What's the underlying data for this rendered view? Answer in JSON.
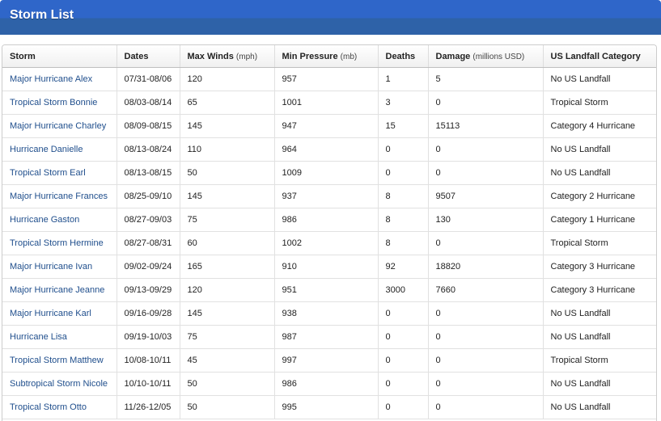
{
  "header": {
    "title": "Storm List"
  },
  "table": {
    "columns": [
      {
        "label": "Storm",
        "unit": ""
      },
      {
        "label": "Dates",
        "unit": ""
      },
      {
        "label": "Max Winds",
        "unit": "(mph)"
      },
      {
        "label": "Min Pressure",
        "unit": "(mb)"
      },
      {
        "label": "Deaths",
        "unit": ""
      },
      {
        "label": "Damage",
        "unit": "(millions USD)"
      },
      {
        "label": "US Landfall Category",
        "unit": ""
      }
    ],
    "rows": [
      [
        "Major Hurricane Alex",
        "07/31-08/06",
        "120",
        "957",
        "1",
        "5",
        "No US Landfall"
      ],
      [
        "Tropical Storm Bonnie",
        "08/03-08/14",
        "65",
        "1001",
        "3",
        "0",
        "Tropical Storm"
      ],
      [
        "Major Hurricane Charley",
        "08/09-08/15",
        "145",
        "947",
        "15",
        "15113",
        "Category 4 Hurricane"
      ],
      [
        "Hurricane Danielle",
        "08/13-08/24",
        "110",
        "964",
        "0",
        "0",
        "No US Landfall"
      ],
      [
        "Tropical Storm Earl",
        "08/13-08/15",
        "50",
        "1009",
        "0",
        "0",
        "No US Landfall"
      ],
      [
        "Major Hurricane Frances",
        "08/25-09/10",
        "145",
        "937",
        "8",
        "9507",
        "Category 2 Hurricane"
      ],
      [
        "Hurricane Gaston",
        "08/27-09/03",
        "75",
        "986",
        "8",
        "130",
        "Category 1 Hurricane"
      ],
      [
        "Tropical Storm Hermine",
        "08/27-08/31",
        "60",
        "1002",
        "8",
        "0",
        "Tropical Storm"
      ],
      [
        "Major Hurricane Ivan",
        "09/02-09/24",
        "165",
        "910",
        "92",
        "18820",
        "Category 3 Hurricane"
      ],
      [
        "Major Hurricane Jeanne",
        "09/13-09/29",
        "120",
        "951",
        "3000",
        "7660",
        "Category 3 Hurricane"
      ],
      [
        "Major Hurricane Karl",
        "09/16-09/28",
        "145",
        "938",
        "0",
        "0",
        "No US Landfall"
      ],
      [
        "Hurricane Lisa",
        "09/19-10/03",
        "75",
        "987",
        "0",
        "0",
        "No US Landfall"
      ],
      [
        "Tropical Storm Matthew",
        "10/08-10/11",
        "45",
        "997",
        "0",
        "0",
        "Tropical Storm"
      ],
      [
        "Subtropical Storm Nicole",
        "10/10-10/11",
        "50",
        "986",
        "0",
        "0",
        "No US Landfall"
      ],
      [
        "Tropical Storm Otto",
        "11/26-12/05",
        "50",
        "995",
        "0",
        "0",
        "No US Landfall"
      ]
    ]
  }
}
